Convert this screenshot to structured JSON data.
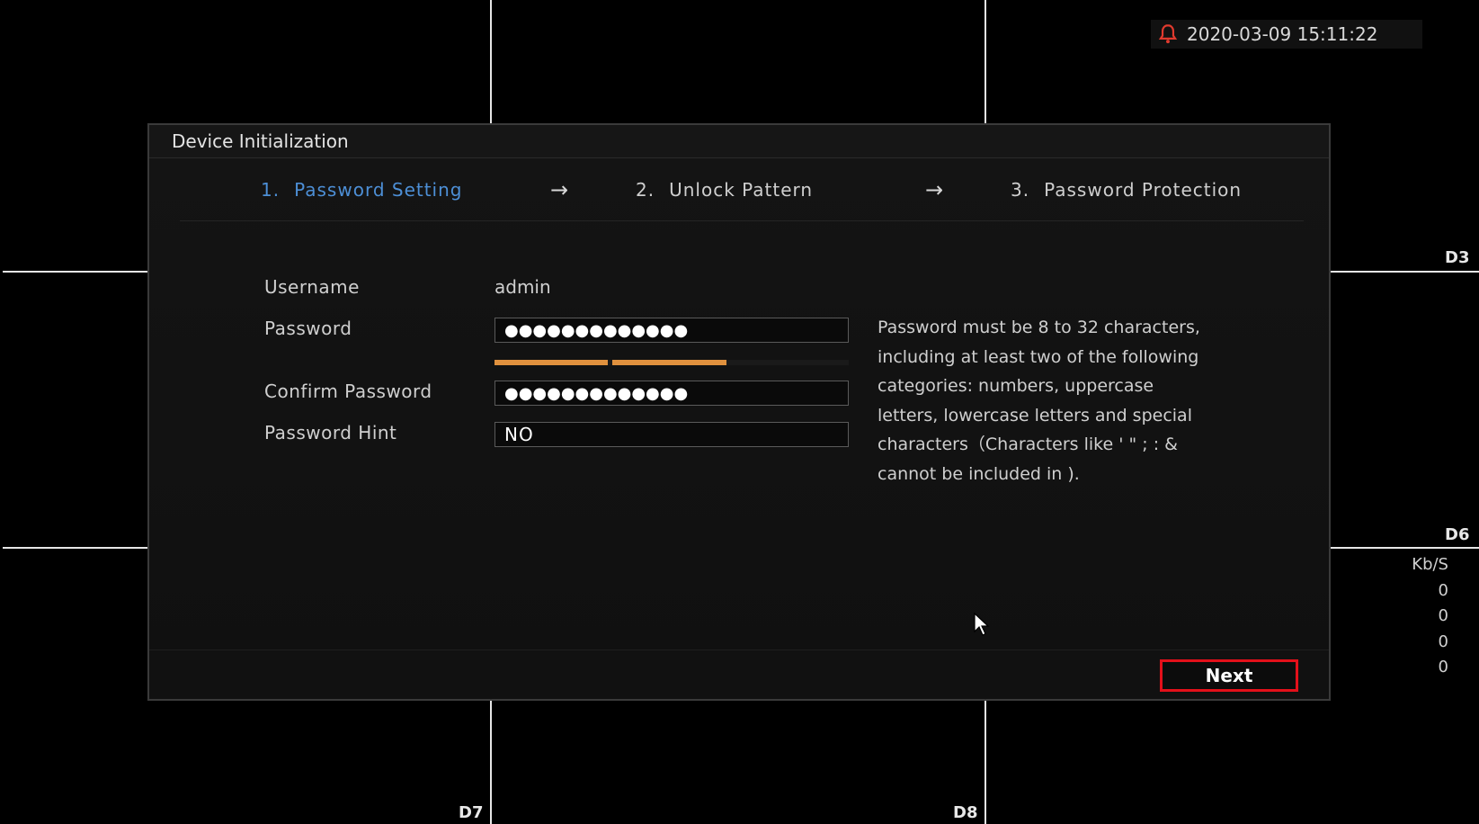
{
  "clock": {
    "datetime": "2020-03-09 15:11:22",
    "icon": "bell-icon",
    "icon_color": "#e03a2e"
  },
  "channels": {
    "d3": "D3",
    "d6": "D6",
    "d7": "D7",
    "d8": "D8"
  },
  "bitrate": {
    "unit": "Kb/S",
    "values": [
      "0",
      "0",
      "0",
      "0"
    ]
  },
  "dialog": {
    "title": "Device Initialization",
    "steps": [
      {
        "number": "1.",
        "label": "Password Setting",
        "active": true
      },
      {
        "number": "2.",
        "label": "Unlock Pattern",
        "active": false
      },
      {
        "number": "3.",
        "label": "Password Protection",
        "active": false
      }
    ],
    "arrow_glyph": "→",
    "form": {
      "username_label": "Username",
      "username_value": "admin",
      "password_label": "Password",
      "password_value": "●●●●●●●●●●●●●",
      "password_strength_segments_filled": 2,
      "password_strength_segments_total": 3,
      "confirm_label": "Confirm Password",
      "confirm_value": "●●●●●●●●●●●●●",
      "hint_label": "Password Hint",
      "hint_value": "NO"
    },
    "hint_lines": [
      "Password must be 8 to 32 characters,",
      "including at least two of the following",
      "categories: numbers, uppercase",
      "letters, lowercase letters and special",
      "characters（Characters like ' \" ; : &",
      "cannot be included in )."
    ],
    "next_label": "Next"
  },
  "colors": {
    "active_step": "#4d8fd6",
    "strength_bar": "#e0913e",
    "next_highlight": "#e3101a"
  }
}
